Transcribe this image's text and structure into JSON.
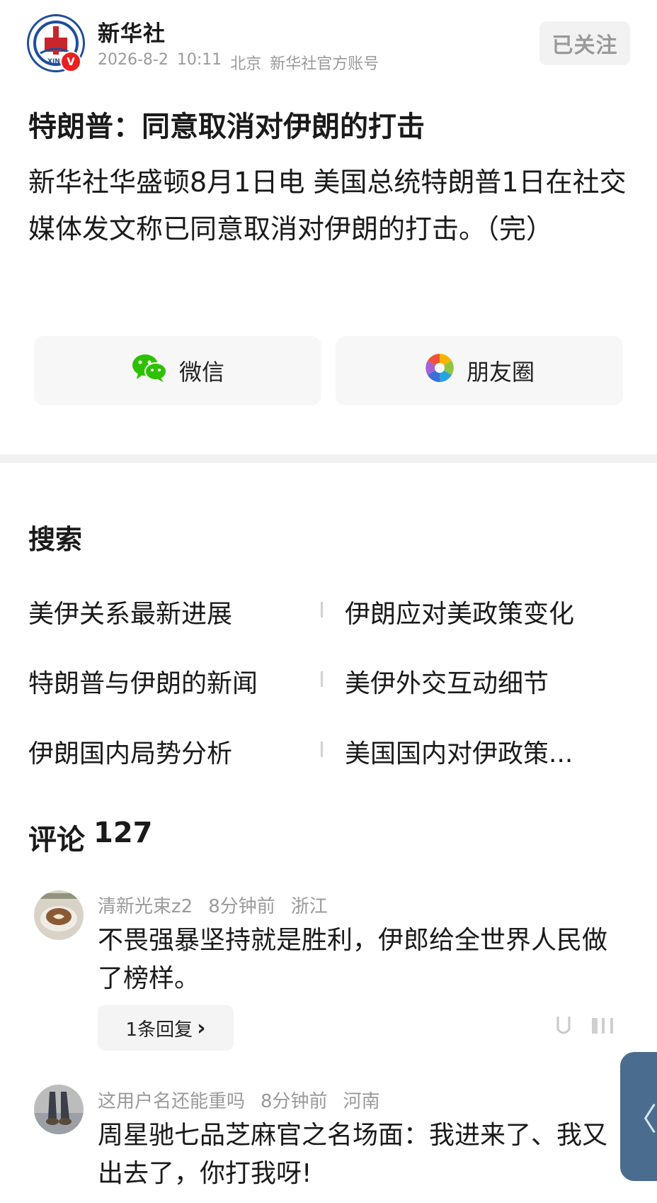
{
  "header": {
    "account_name": "新华社",
    "date": "2026-8-2",
    "time": "10:11",
    "location": "北京",
    "account_type": "新华社官方账号",
    "verified_mark": "V",
    "follow_label": "已关注",
    "logo_icon": "xinhua-logo-icon"
  },
  "article": {
    "title": "特朗普：同意取消对伊朗的打击",
    "body": "新华社华盛顿8月1日电 美国总统特朗普1日在社交媒体发文称已同意取消对伊朗的打击。（完）"
  },
  "share": {
    "wechat_label": "微信",
    "moments_label": "朋友圈",
    "wechat_icon": "wechat-icon",
    "moments_icon": "moments-icon"
  },
  "search": {
    "heading": "搜索",
    "items": [
      "美伊关系最新进展",
      "伊朗应对美政策变化",
      "特朗普与伊朗的新闻",
      "美伊外交互动细节",
      "伊朗国内局势分析",
      "美国国内对伊政策..."
    ]
  },
  "comments": {
    "heading": "评论",
    "count": "127",
    "items": [
      {
        "user": "清新光束z2",
        "time": "8分钟前",
        "region": "浙江",
        "text": "不畏强暴坚持就是胜利，伊郎给全世界人民做了榜样。",
        "reply_label": "1条回复",
        "reply_chevron": "›"
      },
      {
        "user": "这用户名还能重吗",
        "time": "8分钟前",
        "region": "河南",
        "text": "周星驰七品芝麻官之名场面：我进来了、我又出去了，你打我呀!"
      }
    ]
  },
  "side_tab": {
    "arrow": "〈"
  },
  "colors": {
    "logo_blue": "#1e4e9c",
    "badge_red": "#e8201f",
    "wechat_green": "#2dc100",
    "side_tab": "#4a6c8f",
    "muted_text": "#9a9a9a"
  }
}
